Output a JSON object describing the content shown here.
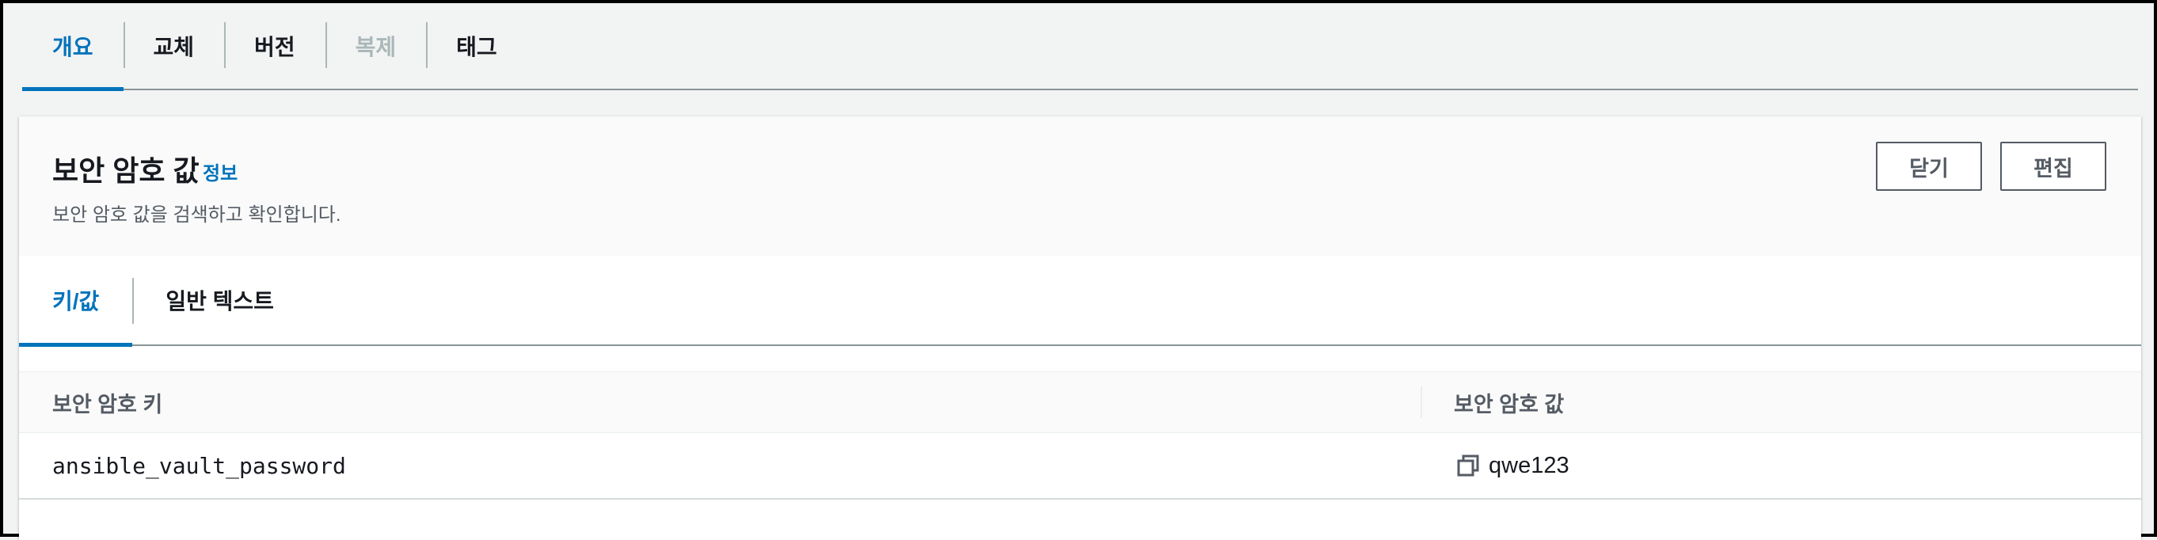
{
  "top_tabs": [
    {
      "label": "개요",
      "state": "active"
    },
    {
      "label": "교체",
      "state": "normal"
    },
    {
      "label": "버전",
      "state": "normal"
    },
    {
      "label": "복제",
      "state": "disabled"
    },
    {
      "label": "태그",
      "state": "normal"
    }
  ],
  "panel": {
    "title": "보안 암호 값",
    "info_link": "정보",
    "description": "보안 암호 값을 검색하고 확인합니다.",
    "close_button": "닫기",
    "edit_button": "편집"
  },
  "inner_tabs": [
    {
      "label": "키/값",
      "state": "active"
    },
    {
      "label": "일반 텍스트",
      "state": "normal"
    }
  ],
  "table": {
    "columns": [
      "보안 암호 키",
      "보안 암호 값"
    ],
    "rows": [
      {
        "key": "ansible_vault_password",
        "value": "qwe123",
        "icon": "copy-icon"
      }
    ]
  },
  "colors": {
    "accent": "#0073bb",
    "text": "#16191f",
    "secondary_text": "#545b64",
    "disabled": "#aab7b8"
  }
}
